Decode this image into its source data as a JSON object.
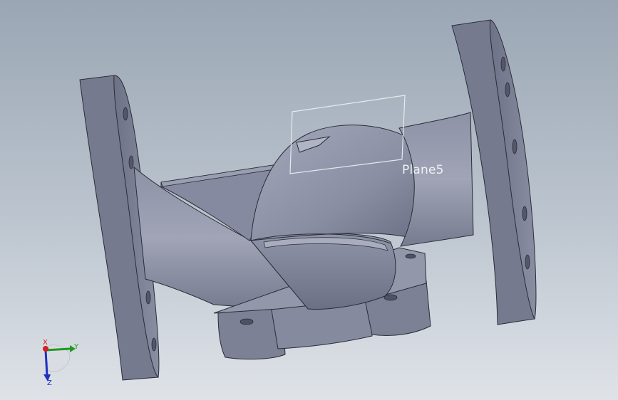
{
  "viewport": {
    "plane_label": "Plane5"
  },
  "triad": {
    "x_label": "X",
    "y_label": "Y",
    "z_label": "Z",
    "x_color": "#d42020",
    "y_color": "#1f9a1f",
    "z_color": "#2030c0"
  }
}
